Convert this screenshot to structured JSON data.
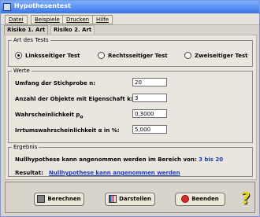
{
  "window": {
    "title": "Hypothesentest"
  },
  "menu": {
    "items": [
      "Datei",
      "Beispiele",
      "Drucken",
      "Hilfe"
    ]
  },
  "tabs": [
    "Risiko 1. Art",
    "Risiko 2. Art"
  ],
  "test_type": {
    "title": "Art des Tests",
    "options": [
      {
        "label": "Linksseitiger Test",
        "selected": true
      },
      {
        "label": "Rechtsseitiger Test",
        "selected": false
      },
      {
        "label": "Zweiseitiger Test",
        "selected": false
      }
    ]
  },
  "values": {
    "title": "Werte",
    "fields": [
      {
        "label": "Umfang der Stichprobe n:",
        "value": "20"
      },
      {
        "label": "Anzahl der Objekte mit Eigenschaft k:",
        "value": "3"
      },
      {
        "label": "Wahrscheinlichkeit p",
        "sub": "o",
        "value": "0,3000"
      },
      {
        "label": "Irrtumswahrscheinlichkeit α in %:",
        "value": "5,000"
      }
    ]
  },
  "result": {
    "title": "Ergebnis",
    "line": "Nullhypothese kann angenommen werden im Bereich von:",
    "range": "3 bis 20",
    "result_label": "Resultat:",
    "result_text": "Nullhypothese kann angenommen werden"
  },
  "buttons": {
    "calculate": "Berechnen",
    "display": "Darstellen",
    "quit": "Beenden"
  },
  "help": {
    "symbol": "?"
  }
}
